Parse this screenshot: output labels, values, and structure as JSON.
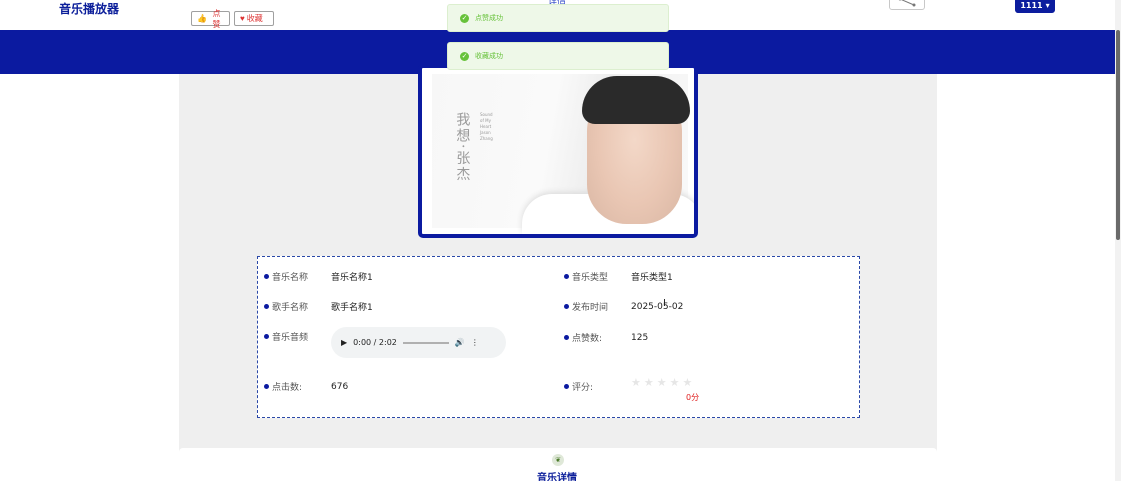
{
  "app": {
    "brand": "音乐播放器",
    "detail_tab": "详情",
    "user": "1111"
  },
  "actions": {
    "like_label": "点赞",
    "favorite_label": "收藏"
  },
  "toasts": [
    {
      "text": "点赞成功"
    },
    {
      "text": "收藏成功"
    }
  ],
  "cover": {
    "title": "我想·张杰",
    "subtitle": "Sound of My Heart Jason Zhang"
  },
  "info": {
    "music_name_label": "音乐名称",
    "music_name": "音乐名称1",
    "music_type_label": "音乐类型",
    "music_type": "音乐类型1",
    "singer_label": "歌手名称",
    "singer": "歌手名称1",
    "release_label": "发布时间",
    "release_date": "2025-05-02",
    "audio_label": "音乐音频",
    "audio_time": "0:00 / 2:02",
    "likes_label": "点赞数:",
    "likes": "125",
    "clicks_label": "点击数:",
    "clicks": "676",
    "rating_label": "评分:",
    "rating": "0分",
    "stars": "★★★★★",
    "rating_value": 0
  },
  "section": {
    "title": "音乐详情"
  },
  "colors": {
    "primary": "#0b1aa0",
    "success": "#67c23a",
    "danger": "#e02020"
  }
}
